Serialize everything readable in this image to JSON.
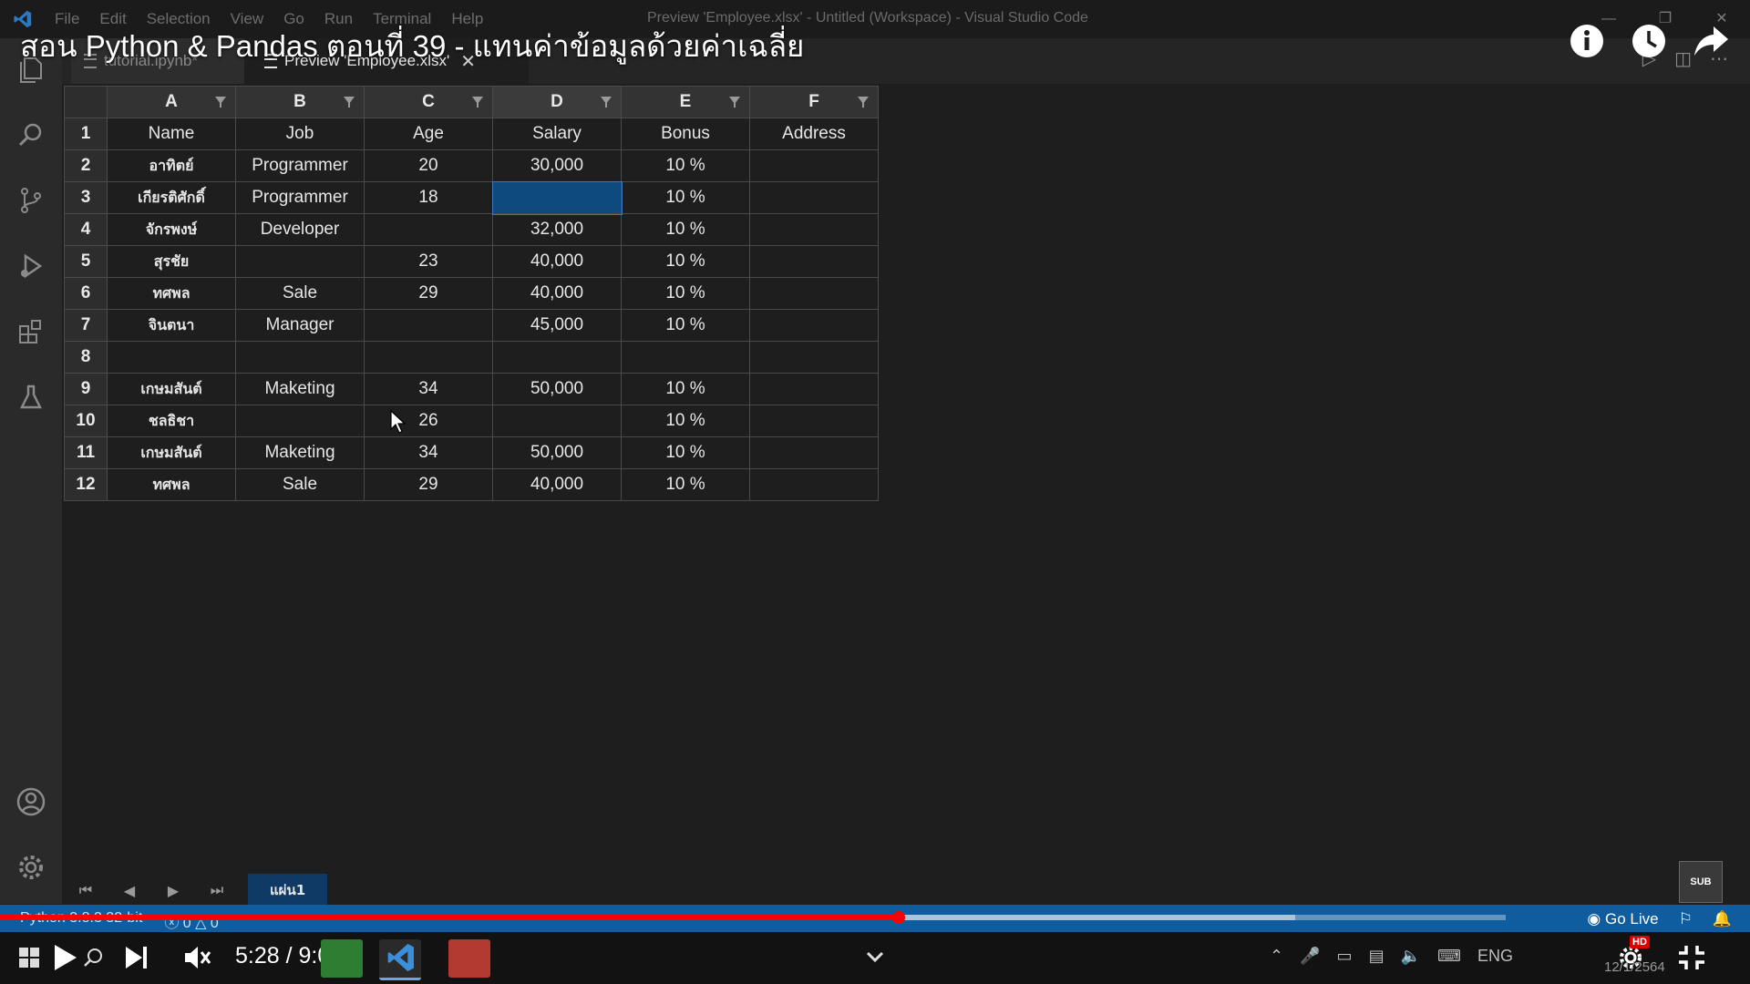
{
  "window": {
    "title": "Preview 'Employee.xlsx' - Untitled (Workspace) - Visual Studio Code",
    "menu": [
      "File",
      "Edit",
      "Selection",
      "View",
      "Go",
      "Run",
      "Terminal",
      "Help"
    ]
  },
  "video": {
    "title": "สอน Python & Pandas ตอนที่ 39 - แทนค่าข้อมูลด้วยค่าเฉลี่ย",
    "current_time": "5:28",
    "duration": "9:08",
    "time_display": "5:28 / 9:08",
    "progress_fraction": 0.597,
    "buffered_fraction": 0.86,
    "badge_sub": "SUB",
    "badge_hd": "HD"
  },
  "tabs": [
    {
      "label": "tutorial.ipynb*",
      "active": false
    },
    {
      "label": "Preview 'Employee.xlsx'",
      "active": true
    }
  ],
  "sheet": {
    "columns": [
      "A",
      "B",
      "C",
      "D",
      "E",
      "F"
    ],
    "rows": [
      {
        "num": "1",
        "cells": [
          "Name",
          "Job",
          "Age",
          "Salary",
          "Bonus",
          "Address"
        ]
      },
      {
        "num": "2",
        "cells": [
          "อาทิตย์",
          "Programmer",
          "20",
          "30,000",
          "10 %",
          ""
        ]
      },
      {
        "num": "3",
        "cells": [
          "เกียรติศักดิ์",
          "Programmer",
          "18",
          "",
          "10 %",
          ""
        ]
      },
      {
        "num": "4",
        "cells": [
          "จักรพงษ์",
          "Developer",
          "",
          "32,000",
          "10 %",
          ""
        ]
      },
      {
        "num": "5",
        "cells": [
          "สุรชัย",
          "",
          "23",
          "40,000",
          "10 %",
          ""
        ]
      },
      {
        "num": "6",
        "cells": [
          "ทศพล",
          "Sale",
          "29",
          "40,000",
          "10 %",
          ""
        ]
      },
      {
        "num": "7",
        "cells": [
          "จินตนา",
          "Manager",
          "",
          "45,000",
          "10 %",
          ""
        ]
      },
      {
        "num": "8",
        "cells": [
          "",
          "",
          "",
          "",
          "",
          ""
        ]
      },
      {
        "num": "9",
        "cells": [
          "เกษมสันต์",
          "Maketing",
          "34",
          "50,000",
          "10 %",
          ""
        ]
      },
      {
        "num": "10",
        "cells": [
          "ชลธิชา",
          "",
          "26",
          "",
          "10 %",
          ""
        ]
      },
      {
        "num": "11",
        "cells": [
          "เกษมสันต์",
          "Maketing",
          "34",
          "50,000",
          "10 %",
          ""
        ]
      },
      {
        "num": "12",
        "cells": [
          "ทศพล",
          "Sale",
          "29",
          "40,000",
          "10 %",
          ""
        ]
      }
    ],
    "sheet_tab": "แผ่น1"
  },
  "status": {
    "python": "Python 3.8.3 32-bit",
    "problems": "0",
    "warnings": "0",
    "go_live": "Go Live"
  },
  "taskbar": {
    "date": "12/1/2564",
    "lang": "ENG"
  },
  "colors": {
    "statusbar": "#0f5d9e",
    "selection": "#0e4a7e",
    "progress": "#ff0000"
  }
}
